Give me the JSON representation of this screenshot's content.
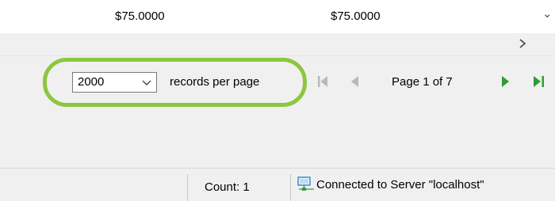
{
  "grid": {
    "row": {
      "col1": "$75.0000",
      "col2": "$75.0000"
    },
    "vscroll_down_glyph": "⌄",
    "hscroll_right_icon": "chevron-right-icon"
  },
  "pager": {
    "records_per_page": {
      "value": "2000",
      "options_visible": [
        "2000"
      ]
    },
    "records_per_page_label": "records per page",
    "page_label": "Page 1 of 7",
    "icons": {
      "first": "first-page-icon",
      "prev": "previous-page-icon",
      "next": "next-page-icon",
      "last": "last-page-icon"
    },
    "highlight_color": "#8dc63f",
    "nav_active_color": "#2e9e2e",
    "nav_disabled_color": "#b9b9b9"
  },
  "status": {
    "count": "Count: 1",
    "connection": "Connected to Server \"localhost\"",
    "connection_icon": "server-connection-icon"
  }
}
